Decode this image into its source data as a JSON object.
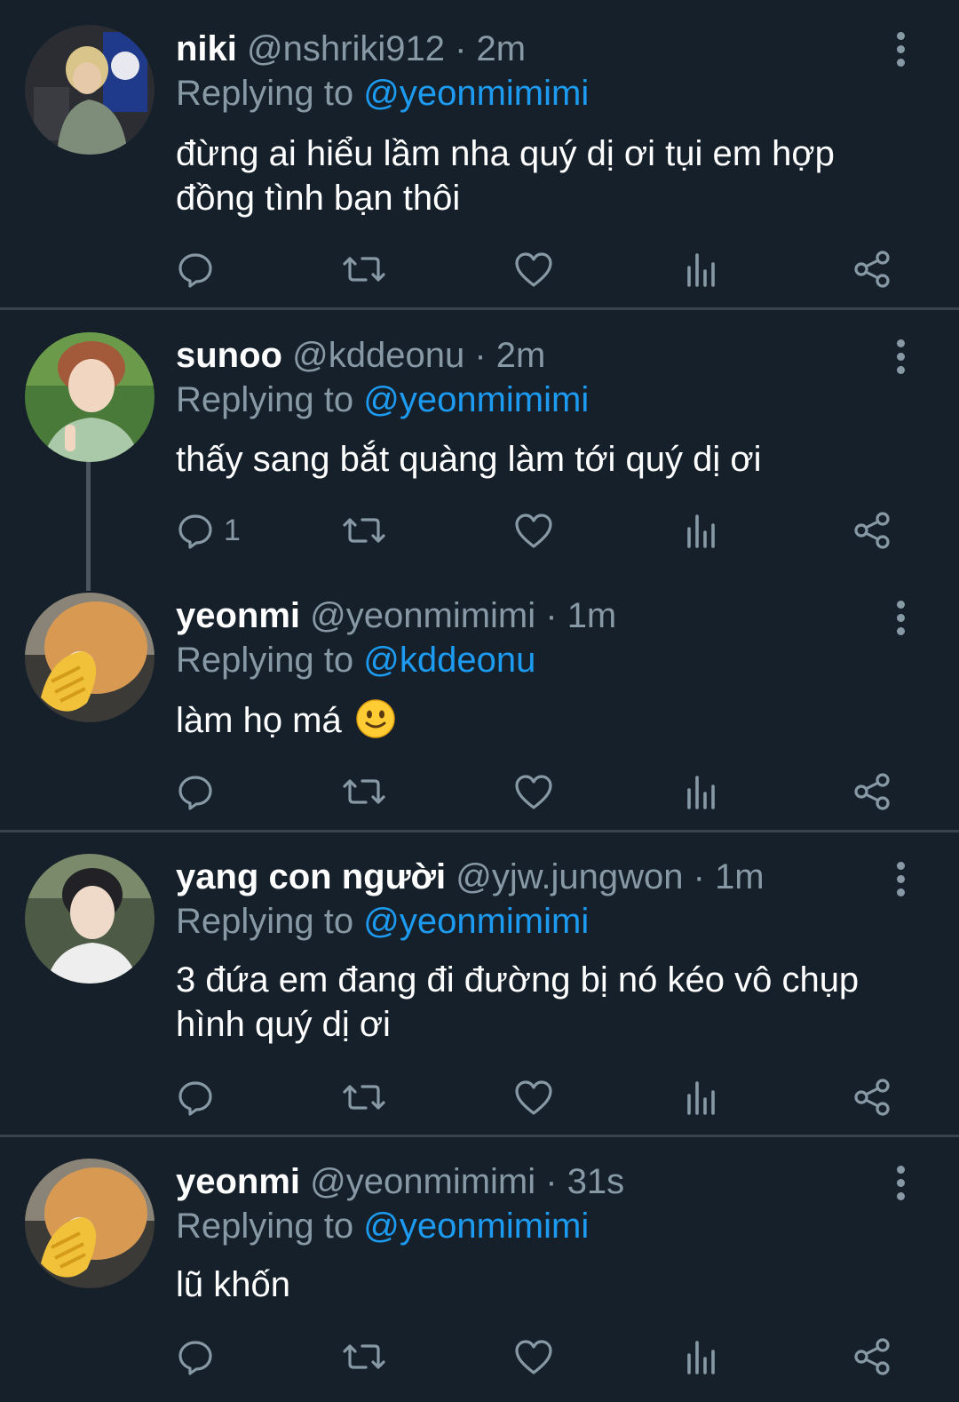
{
  "tweets": [
    {
      "name": "niki",
      "handle": "@nshriki912",
      "time": "2m",
      "replying_prefix": "Replying to ",
      "replying_to": "@yeonmimimi",
      "text": "đừng ai hiểu lầm nha quý dị ơi tụi em hợp đồng tình bạn thôi",
      "reply_count": ""
    },
    {
      "name": "sunoo",
      "handle": "@kddeonu",
      "time": "2m",
      "replying_prefix": "Replying to ",
      "replying_to": "@yeonmimimi",
      "text": "thấy sang bắt quàng làm tới quý dị ơi",
      "reply_count": "1"
    },
    {
      "name": "yeonmi",
      "handle": "@yeonmimimi",
      "time": "1m",
      "replying_prefix": "Replying to ",
      "replying_to": "@kddeonu",
      "text": "làm họ má",
      "emoji": "slightly-smiling-face",
      "reply_count": ""
    },
    {
      "name": "yang con người",
      "handle": "@yjw.jungwon",
      "time": "1m",
      "replying_prefix": "Replying to ",
      "replying_to": "@yeonmimimi",
      "text": "3 đứa em đang đi đường bị nó kéo vô chụp hình quý dị ơi",
      "reply_count": ""
    },
    {
      "name": "yeonmi",
      "handle": "@yeonmimimi",
      "time": "31s",
      "replying_prefix": "Replying to ",
      "replying_to": "@yeonmimimi",
      "text": "lũ khốn",
      "reply_count": ""
    }
  ],
  "separator": " · ",
  "colors": {
    "background": "#15202b",
    "secondary_text": "#8899a6",
    "mention": "#1d9bf0",
    "divider": "#38444d"
  },
  "icons": [
    "reply-icon",
    "retweet-icon",
    "like-icon",
    "analytics-icon",
    "share-icon",
    "more-options-icon"
  ]
}
